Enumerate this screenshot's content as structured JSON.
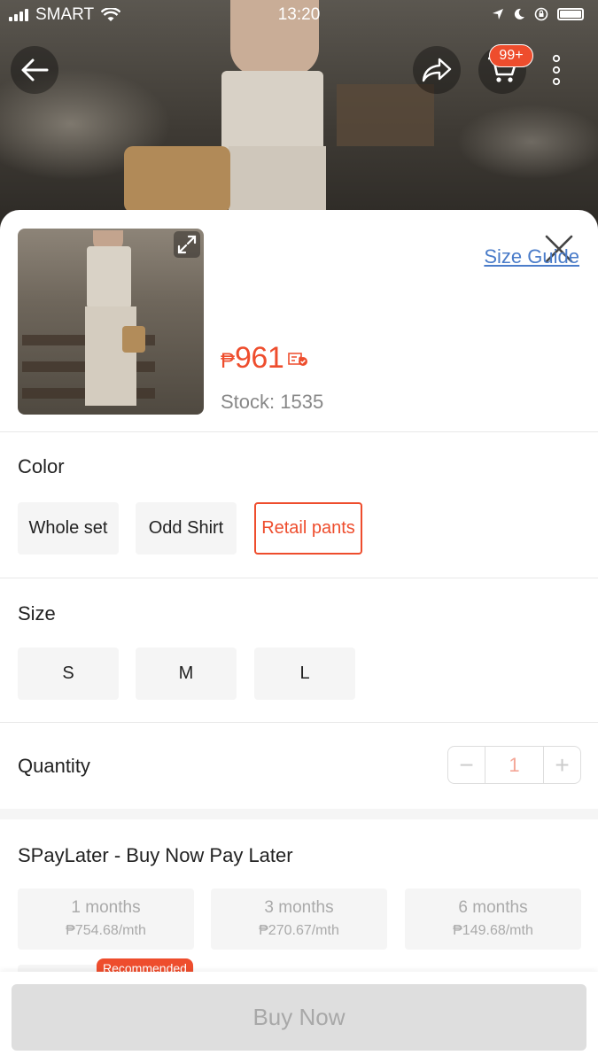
{
  "status_bar": {
    "carrier": "SMART",
    "time": "13:20"
  },
  "header": {
    "cart_badge": "99+"
  },
  "product": {
    "currency": "₱",
    "price": "961",
    "stock_label": "Stock: 1535"
  },
  "color_section": {
    "title": "Color",
    "size_guide_label": "Size Guide",
    "options": [
      "Whole set",
      "Odd Shirt",
      "Retail pants"
    ],
    "selected": "Retail pants"
  },
  "size_section": {
    "title": "Size",
    "options": [
      "S",
      "M",
      "L"
    ]
  },
  "quantity_section": {
    "title": "Quantity",
    "value": "1",
    "minus": "−",
    "plus": "+"
  },
  "paylater": {
    "title": "SPayLater - Buy Now Pay Later",
    "plans": [
      {
        "months": "1 months",
        "rate": "₱754.68/mth"
      },
      {
        "months": "3 months",
        "rate": "₱270.67/mth"
      },
      {
        "months": "6 months",
        "rate": "₱149.68/mth"
      }
    ],
    "recommended_label": "Recommended"
  },
  "footer": {
    "buy_label": "Buy Now"
  },
  "colors": {
    "accent": "#ee4d2d",
    "link": "#4a7cc9",
    "disabled_button": "#dedede"
  }
}
